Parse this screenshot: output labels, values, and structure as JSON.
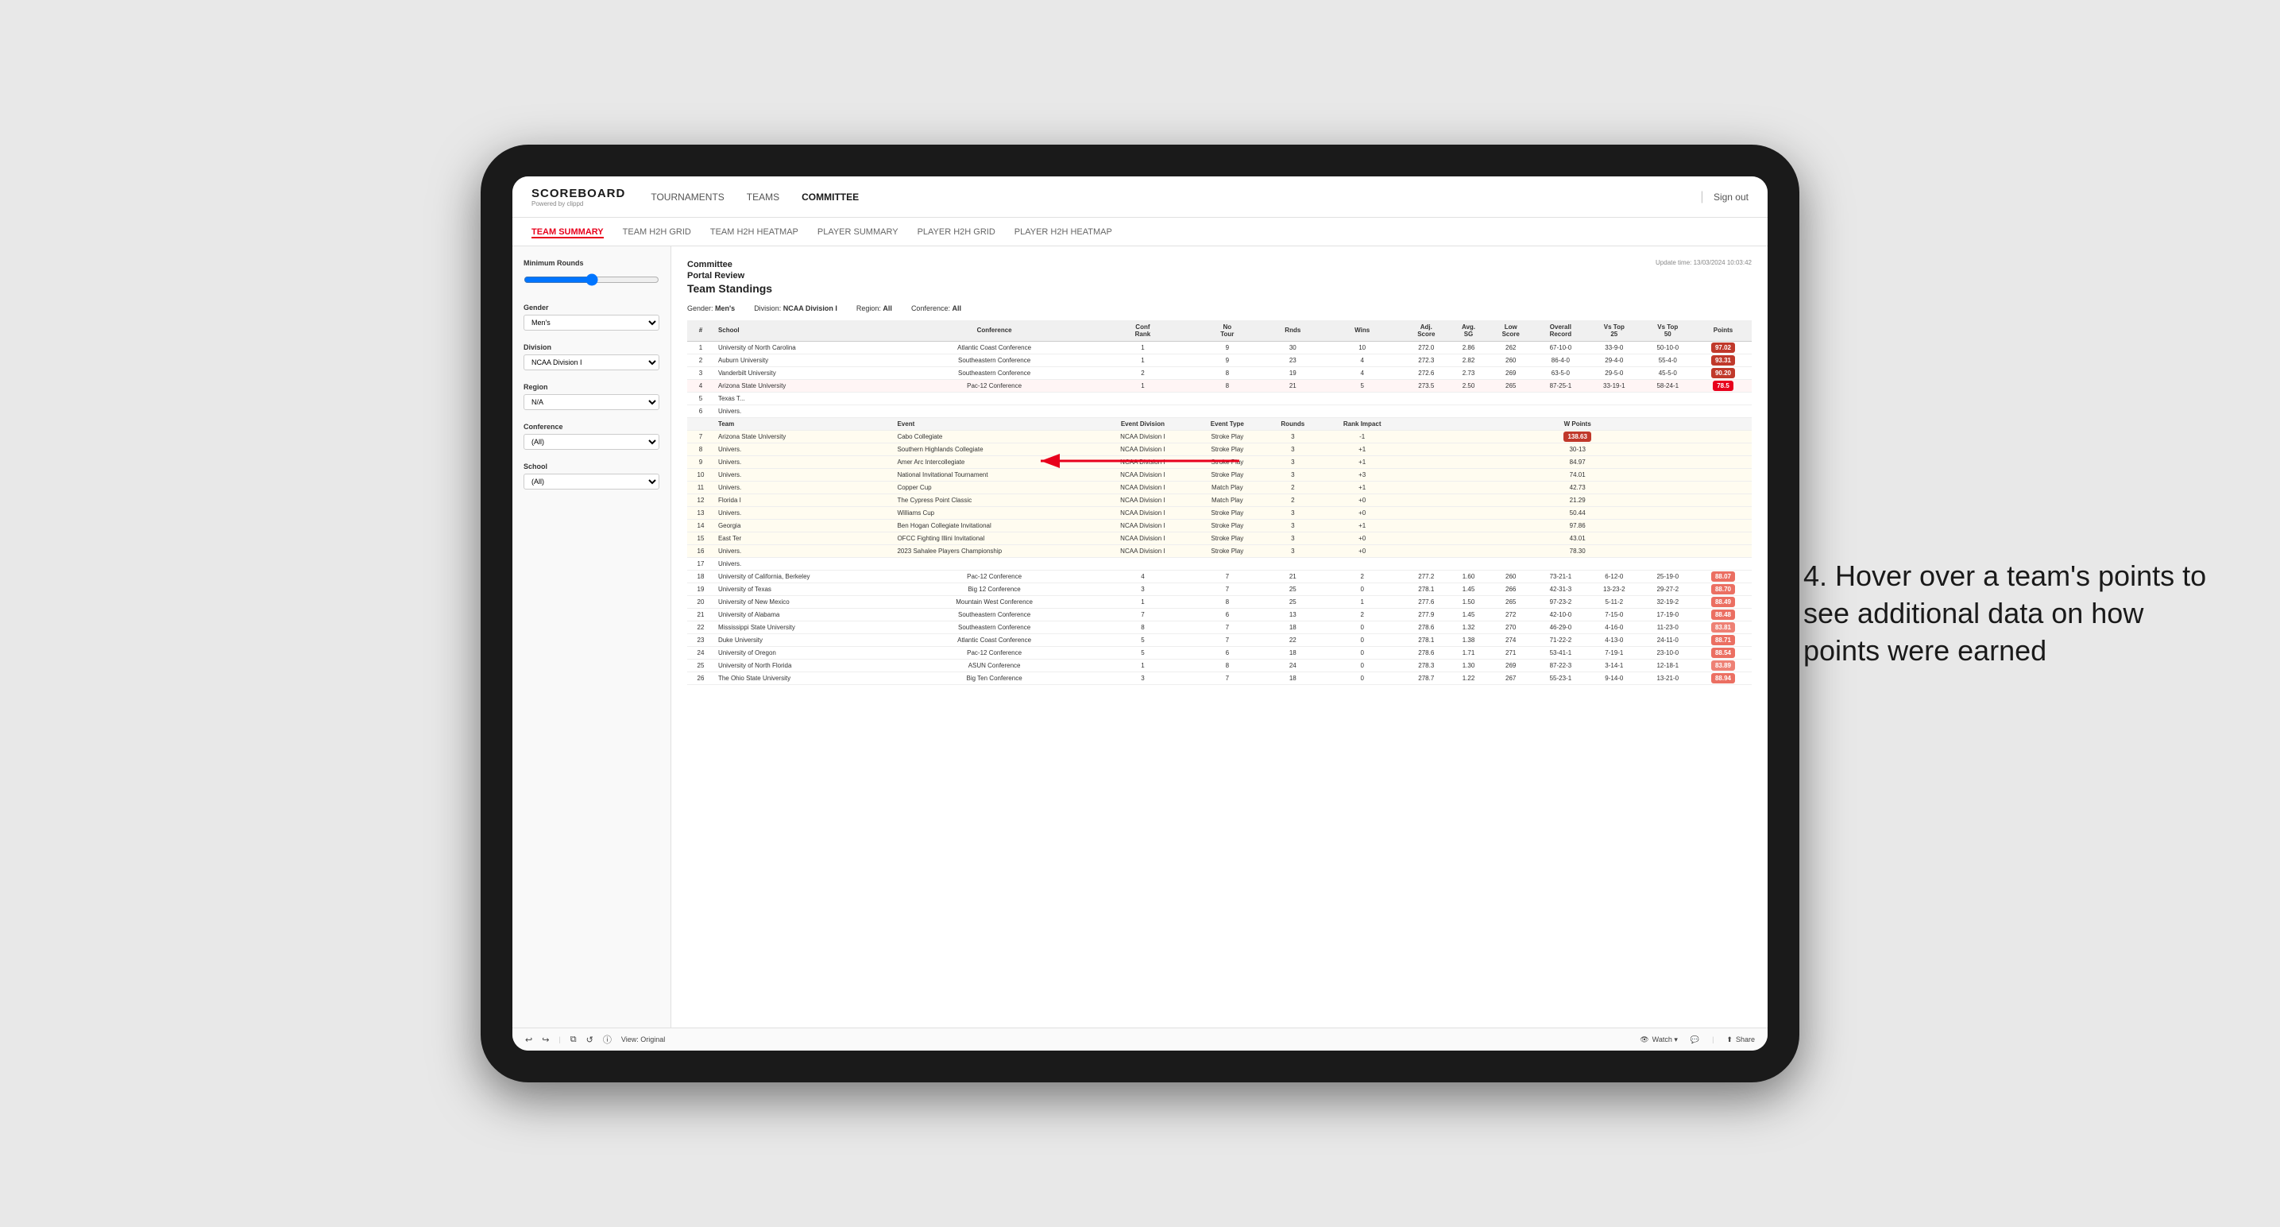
{
  "app": {
    "logo": "SCOREBOARD",
    "logo_sub": "Powered by clippd",
    "sign_out_sep": "|",
    "sign_out_label": "Sign out"
  },
  "nav": {
    "items": [
      {
        "label": "TOURNAMENTS",
        "active": false
      },
      {
        "label": "TEAMS",
        "active": false
      },
      {
        "label": "COMMITTEE",
        "active": true
      }
    ]
  },
  "sub_nav": {
    "items": [
      {
        "label": "TEAM SUMMARY",
        "active": true
      },
      {
        "label": "TEAM H2H GRID",
        "active": false
      },
      {
        "label": "TEAM H2H HEATMAP",
        "active": false
      },
      {
        "label": "PLAYER SUMMARY",
        "active": false
      },
      {
        "label": "PLAYER H2H GRID",
        "active": false
      },
      {
        "label": "PLAYER H2H HEATMAP",
        "active": false
      }
    ]
  },
  "sidebar": {
    "min_rounds_label": "Minimum Rounds",
    "gender_label": "Gender",
    "gender_value": "Men's",
    "division_label": "Division",
    "division_value": "NCAA Division I",
    "region_label": "Region",
    "region_value": "N/A",
    "conference_label": "Conference",
    "conference_value": "(All)",
    "school_label": "School",
    "school_value": "(All)"
  },
  "report": {
    "committee_label": "Committee",
    "portal_label": "Portal Review",
    "title": "Team Standings",
    "update_time": "Update time: 13/03/2024 10:03:42",
    "filters": {
      "gender": {
        "label": "Gender:",
        "value": "Men's"
      },
      "division": {
        "label": "Division:",
        "value": "NCAA Division I"
      },
      "region": {
        "label": "Region:",
        "value": "All"
      },
      "conference": {
        "label": "Conference:",
        "value": "All"
      }
    },
    "columns": [
      "#",
      "School",
      "Conference",
      "Conf Rank",
      "No Tour",
      "Rnds",
      "Wins",
      "Adj. Score",
      "Avg. SG",
      "Low Score",
      "Overall Record",
      "Vs Top 25",
      "Vs Top 50",
      "Points"
    ],
    "rows": [
      {
        "rank": "1",
        "school": "University of North Carolina",
        "conference": "Atlantic Coast Conference",
        "conf_rank": "1",
        "tours": "9",
        "rnds": "30",
        "wins": "10",
        "adj_score": "272.0",
        "avg_sg": "2.86",
        "low_score": "262",
        "record": "67-10-0",
        "vs25": "33-9-0",
        "vs50": "50-10-0",
        "points": "97.02",
        "highlight": true
      },
      {
        "rank": "2",
        "school": "Auburn University",
        "conference": "Southeastern Conference",
        "conf_rank": "1",
        "tours": "9",
        "rnds": "23",
        "wins": "4",
        "adj_score": "272.3",
        "avg_sg": "2.82",
        "low_score": "260",
        "record": "86-4-0",
        "vs25": "29-4-0",
        "vs50": "55-4-0",
        "points": "93.31"
      },
      {
        "rank": "3",
        "school": "Vanderbilt University",
        "conference": "Southeastern Conference",
        "conf_rank": "2",
        "tours": "8",
        "rnds": "19",
        "wins": "4",
        "adj_score": "272.6",
        "avg_sg": "2.73",
        "low_score": "269",
        "record": "63-5-0",
        "vs25": "29-5-0",
        "vs50": "45-5-0",
        "points": "90.20"
      },
      {
        "rank": "4",
        "school": "Arizona State University",
        "conference": "Pac-12 Conference",
        "conf_rank": "1",
        "tours": "8",
        "rnds": "21",
        "wins": "5",
        "adj_score": "273.5",
        "avg_sg": "2.50",
        "low_score": "265",
        "record": "87-25-1",
        "vs25": "33-19-1",
        "vs50": "58-24-1",
        "points": "78.5",
        "expanded": true,
        "red_highlight": true
      },
      {
        "rank": "5",
        "school": "Texas T...",
        "conference": "",
        "conf_rank": "",
        "tours": "",
        "rnds": "",
        "wins": "",
        "adj_score": "",
        "avg_sg": "",
        "low_score": "",
        "record": "",
        "vs25": "",
        "vs50": "",
        "points": ""
      },
      {
        "rank": "6",
        "school": "Univers.",
        "conference": "",
        "conf_rank": "",
        "tours": "",
        "rnds": "",
        "wins": "",
        "adj_score": "",
        "avg_sg": "",
        "low_score": "",
        "record": "",
        "vs25": "",
        "vs50": "",
        "points": "",
        "tooltip": true
      },
      {
        "rank": "7",
        "school": "Arizona State University",
        "conference": "Cabo Collegiate",
        "conf_rank": "",
        "tours": "",
        "rnds": "",
        "wins": "",
        "adj_score": "",
        "avg_sg": "",
        "low_score": "",
        "record": "",
        "vs25": "",
        "vs50": "",
        "points": "138.63",
        "tooltip_row": true
      },
      {
        "rank": "8",
        "school": "Univers.",
        "conference": "Southern Highlands Collegiate",
        "conf_rank": "",
        "tours": "",
        "rnds": "",
        "wins": "",
        "adj_score": "",
        "avg_sg": "",
        "low_score": "",
        "record": "",
        "vs25": "",
        "vs50": "",
        "points": "30-13",
        "tooltip_row": true
      },
      {
        "rank": "9",
        "school": "Univers.",
        "conference": "Amer Arc Intercollegiate",
        "conf_rank": "",
        "tours": "",
        "rnds": "",
        "wins": "",
        "adj_score": "",
        "avg_sg": "",
        "low_score": "",
        "record": "",
        "vs25": "",
        "vs50": "",
        "points": "84.97",
        "tooltip_row": true
      },
      {
        "rank": "10",
        "school": "Univers.",
        "conference": "National Invitational Tournament",
        "conf_rank": "",
        "tours": "",
        "rnds": "",
        "wins": "",
        "adj_score": "",
        "avg_sg": "",
        "low_score": "",
        "record": "",
        "vs25": "",
        "vs50": "",
        "points": "74.01",
        "tooltip_row": true
      },
      {
        "rank": "11",
        "school": "Univers.",
        "conference": "Copper Cup",
        "conf_rank": "",
        "tours": "",
        "rnds": "",
        "wins": "",
        "adj_score": "",
        "avg_sg": "",
        "low_score": "",
        "record": "",
        "vs25": "",
        "vs50": "",
        "points": "42.73",
        "tooltip_row": true
      },
      {
        "rank": "12",
        "school": "Florida I",
        "conference": "The Cypress Point Classic",
        "conf_rank": "",
        "tours": "",
        "rnds": "",
        "wins": "",
        "adj_score": "",
        "avg_sg": "",
        "low_score": "",
        "record": "",
        "vs25": "",
        "vs50": "",
        "points": "21.29",
        "tooltip_row": true
      },
      {
        "rank": "13",
        "school": "Univers.",
        "conference": "Williams Cup",
        "conf_rank": "",
        "tours": "",
        "rnds": "",
        "wins": "",
        "adj_score": "",
        "avg_sg": "",
        "low_score": "",
        "record": "",
        "vs25": "",
        "vs50": "",
        "points": "50.44",
        "tooltip_row": true
      },
      {
        "rank": "14",
        "school": "Georgia",
        "conference": "Ben Hogan Collegiate Invitational",
        "conf_rank": "",
        "tours": "",
        "rnds": "",
        "wins": "",
        "adj_score": "",
        "avg_sg": "",
        "low_score": "",
        "record": "",
        "vs25": "",
        "vs50": "",
        "points": "97.86",
        "tooltip_row": true
      },
      {
        "rank": "15",
        "school": "East Ter",
        "conference": "OFCC Fighting Illini Invitational",
        "conf_rank": "",
        "tours": "",
        "rnds": "",
        "wins": "",
        "adj_score": "",
        "avg_sg": "",
        "low_score": "",
        "record": "",
        "vs25": "",
        "vs50": "",
        "points": "43.01",
        "tooltip_row": true
      },
      {
        "rank": "16",
        "school": "Univers.",
        "conference": "2023 Sahalee Players Championship",
        "conf_rank": "",
        "tours": "",
        "rnds": "",
        "wins": "",
        "adj_score": "",
        "avg_sg": "",
        "low_score": "",
        "record": "",
        "vs25": "",
        "vs50": "",
        "points": "78.30",
        "tooltip_row": true
      },
      {
        "rank": "17",
        "school": "Univers.",
        "conference": "",
        "conf_rank": "",
        "tours": "",
        "rnds": "",
        "wins": "",
        "adj_score": "",
        "avg_sg": "",
        "low_score": "",
        "record": "",
        "vs25": "",
        "vs50": "",
        "points": ""
      },
      {
        "rank": "18",
        "school": "University of California, Berkeley",
        "conference": "Pac-12 Conference",
        "conf_rank": "4",
        "tours": "7",
        "rnds": "21",
        "wins": "2",
        "adj_score": "277.2",
        "avg_sg": "1.60",
        "low_score": "260",
        "record": "73-21-1",
        "vs25": "6-12-0",
        "vs50": "25-19-0",
        "points": "88.07"
      },
      {
        "rank": "19",
        "school": "University of Texas",
        "conference": "Big 12 Conference",
        "conf_rank": "3",
        "tours": "7",
        "rnds": "25",
        "wins": "0",
        "adj_score": "278.1",
        "avg_sg": "1.45",
        "low_score": "266",
        "record": "42-31-3",
        "vs25": "13-23-2",
        "vs50": "29-27-2",
        "points": "88.70"
      },
      {
        "rank": "20",
        "school": "University of New Mexico",
        "conference": "Mountain West Conference",
        "conf_rank": "1",
        "tours": "8",
        "rnds": "25",
        "wins": "1",
        "adj_score": "277.6",
        "avg_sg": "1.50",
        "low_score": "265",
        "record": "97-23-2",
        "vs25": "5-11-2",
        "vs50": "32-19-2",
        "points": "88.49"
      },
      {
        "rank": "21",
        "school": "University of Alabama",
        "conference": "Southeastern Conference",
        "conf_rank": "7",
        "tours": "6",
        "rnds": "13",
        "wins": "2",
        "adj_score": "277.9",
        "avg_sg": "1.45",
        "low_score": "272",
        "record": "42-10-0",
        "vs25": "7-15-0",
        "vs50": "17-19-0",
        "points": "88.48"
      },
      {
        "rank": "22",
        "school": "Mississippi State University",
        "conference": "Southeastern Conference",
        "conf_rank": "8",
        "tours": "7",
        "rnds": "18",
        "wins": "0",
        "adj_score": "278.6",
        "avg_sg": "1.32",
        "low_score": "270",
        "record": "46-29-0",
        "vs25": "4-16-0",
        "vs50": "11-23-0",
        "points": "83.81"
      },
      {
        "rank": "23",
        "school": "Duke University",
        "conference": "Atlantic Coast Conference",
        "conf_rank": "5",
        "tours": "7",
        "rnds": "22",
        "wins": "0",
        "adj_score": "278.1",
        "avg_sg": "1.38",
        "low_score": "274",
        "record": "71-22-2",
        "vs25": "4-13-0",
        "vs50": "24-11-0",
        "points": "88.71"
      },
      {
        "rank": "24",
        "school": "University of Oregon",
        "conference": "Pac-12 Conference",
        "conf_rank": "5",
        "tours": "6",
        "rnds": "18",
        "wins": "0",
        "adj_score": "278.6",
        "avg_sg": "1.71",
        "low_score": "271",
        "record": "53-41-1",
        "vs25": "7-19-1",
        "vs50": "23-10-0",
        "points": "88.54"
      },
      {
        "rank": "25",
        "school": "University of North Florida",
        "conference": "ASUN Conference",
        "conf_rank": "1",
        "tours": "8",
        "rnds": "24",
        "wins": "0",
        "adj_score": "278.3",
        "avg_sg": "1.30",
        "low_score": "269",
        "record": "87-22-3",
        "vs25": "3-14-1",
        "vs50": "12-18-1",
        "points": "83.89"
      },
      {
        "rank": "26",
        "school": "The Ohio State University",
        "conference": "Big Ten Conference",
        "conf_rank": "3",
        "tours": "7",
        "rnds": "18",
        "wins": "0",
        "adj_score": "278.7",
        "avg_sg": "1.22",
        "low_score": "267",
        "record": "55-23-1",
        "vs25": "9-14-0",
        "vs50": "13-21-0",
        "points": "88.94"
      }
    ],
    "tooltip_columns": [
      "Team",
      "Event",
      "Event Division",
      "Event Type",
      "Rounds",
      "Rank Impact",
      "W Points"
    ]
  },
  "bottom_toolbar": {
    "undo": "↩",
    "redo": "↪",
    "separator": "|",
    "copy": "⧉",
    "reset": "↺",
    "info": "ⓘ",
    "view_label": "View: Original",
    "watch_label": "Watch ▾",
    "comment_label": "💬",
    "share_label": "Share"
  },
  "annotation": {
    "text": "4. Hover over a team's points to see additional data on how points were earned"
  }
}
